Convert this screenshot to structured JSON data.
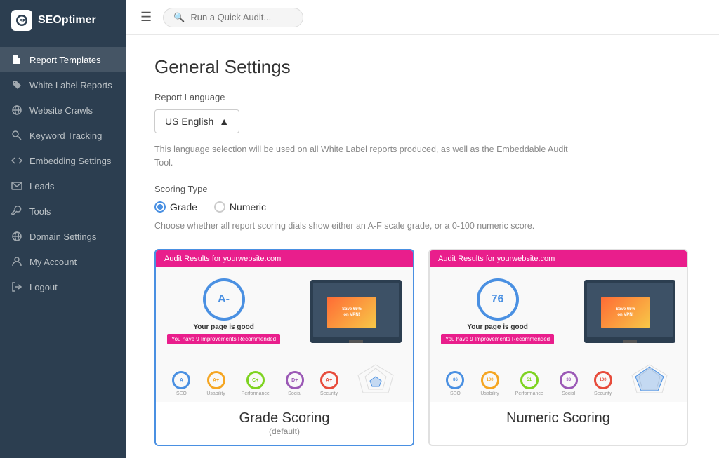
{
  "sidebar": {
    "logo_text": "SEOptimer",
    "items": [
      {
        "id": "report-templates",
        "label": "Report Templates",
        "icon": "file-icon",
        "active": true
      },
      {
        "id": "white-label",
        "label": "White Label Reports",
        "icon": "tag-icon",
        "active": false
      },
      {
        "id": "website-crawls",
        "label": "Website Crawls",
        "icon": "globe-icon",
        "active": false
      },
      {
        "id": "keyword-tracking",
        "label": "Keyword Tracking",
        "icon": "search-icon",
        "active": false
      },
      {
        "id": "embedding-settings",
        "label": "Embedding Settings",
        "icon": "code-icon",
        "active": false
      },
      {
        "id": "leads",
        "label": "Leads",
        "icon": "mail-icon",
        "active": false
      },
      {
        "id": "tools",
        "label": "Tools",
        "icon": "wrench-icon",
        "active": false
      },
      {
        "id": "domain-settings",
        "label": "Domain Settings",
        "icon": "globe2-icon",
        "active": false
      },
      {
        "id": "my-account",
        "label": "My Account",
        "icon": "user-icon",
        "active": false
      },
      {
        "id": "logout",
        "label": "Logout",
        "icon": "logout-icon",
        "active": false
      }
    ]
  },
  "topbar": {
    "search_placeholder": "Run a Quick Audit..."
  },
  "main": {
    "page_title": "General Settings",
    "report_language_label": "Report Language",
    "language_value": "US English",
    "language_help": "This language selection will be used on all White Label reports produced, as well as the Embeddable Audit Tool.",
    "scoring_type_label": "Scoring Type",
    "scoring_options": [
      {
        "id": "grade",
        "label": "Grade",
        "selected": true
      },
      {
        "id": "numeric",
        "label": "Numeric",
        "selected": false
      }
    ],
    "scoring_help": "Choose whether all report scoring dials show either an A-F scale grade, or a 0-100 numeric score.",
    "grade_card": {
      "header": "Audit Results for yourwebsite.com",
      "score": "A-",
      "page_text": "Your page is good",
      "improvement_text": "You have 9 Improvements Recommended",
      "sub_scores": [
        {
          "label": "SEO",
          "value": "A",
          "color": "#4a90e2"
        },
        {
          "label": "Usability",
          "value": "A+",
          "color": "#f5a623"
        },
        {
          "label": "Performance",
          "value": "C+",
          "color": "#7ed321"
        },
        {
          "label": "Social",
          "value": "D+",
          "color": "#9b59b6"
        },
        {
          "label": "Security",
          "value": "A+",
          "color": "#e74c3c"
        }
      ],
      "caption": "Grade Scoring",
      "caption_sub": "(default)"
    },
    "numeric_card": {
      "header": "Audit Results for yourwebsite.com",
      "score": "76",
      "page_text": "Your page is good",
      "improvement_text": "You have 9 Improvements Recommended",
      "sub_scores": [
        {
          "label": "SEO",
          "value": "86",
          "color": "#4a90e2"
        },
        {
          "label": "Usability",
          "value": "100",
          "color": "#f5a623"
        },
        {
          "label": "Performance",
          "value": "51",
          "color": "#7ed321"
        },
        {
          "label": "Social",
          "value": "33",
          "color": "#9b59b6"
        },
        {
          "label": "Security",
          "value": "100",
          "color": "#e74c3c"
        }
      ],
      "caption": "Numeric Scoring",
      "caption_sub": ""
    }
  }
}
